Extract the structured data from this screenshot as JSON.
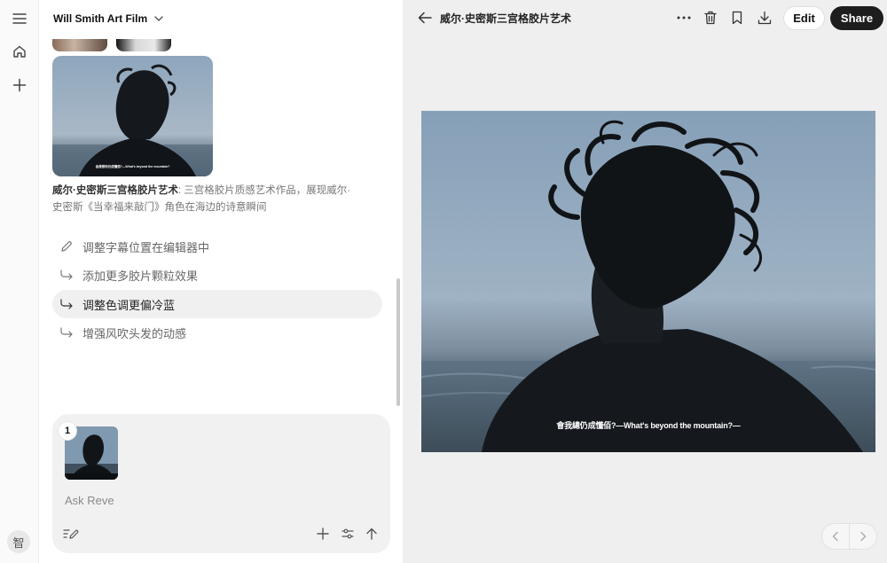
{
  "rail": {
    "icons": [
      "menu-icon",
      "home-icon",
      "plus-icon"
    ],
    "avatar_label": "智"
  },
  "chat": {
    "project_title": "Will Smith Art Film",
    "description_title": "威尔·史密斯三宫格胶片艺术",
    "description_body": ": 三宫格胶片质感艺术作品，展现威尔·史密斯《当幸福来敲门》角色在海边的诗意瞬间",
    "suggestions": [
      {
        "label": "调整字幕位置在编辑器中",
        "icon": "pencil-icon",
        "active": false
      },
      {
        "label": "添加更多胶片颗粒效果",
        "icon": "return-arrow-icon",
        "active": false
      },
      {
        "label": "调整色调更偏冷蓝",
        "icon": "return-arrow-icon",
        "active": true
      },
      {
        "label": "增强风吹头发的动感",
        "icon": "return-arrow-icon",
        "active": false
      }
    ],
    "composer": {
      "attachment_count": "1",
      "placeholder": "Ask Reve"
    }
  },
  "viewer": {
    "title": "威尔·史密斯三宫格胶片艺术",
    "edit_label": "Edit",
    "share_label": "Share",
    "image_subtitle": "會我總仍成懂佰?—What's beyond the mountain?—",
    "thumbnail_subtitle": "会我想你仍成懂佰?—What's beyond the mountain?"
  },
  "colors": {
    "share_button": "#1d1d1d",
    "viewer_background": "#efefef",
    "active_suggestion": "#f0f0f0"
  }
}
